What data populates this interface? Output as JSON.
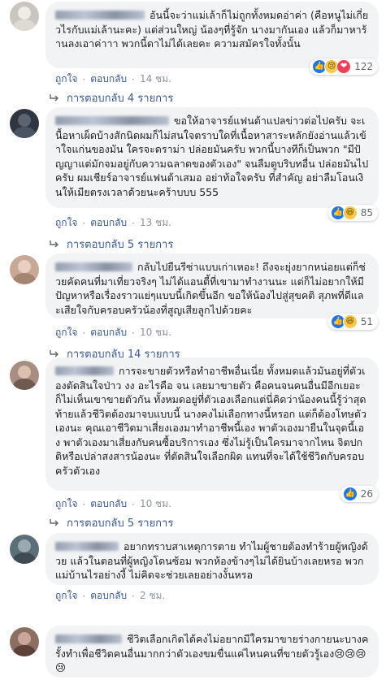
{
  "comments": [
    {
      "text": "อันนี้จะว่าแม่เล้าก็ไม่ถูกทั้งหมดอ่าค่า (คือหนูไม่เกี่ยวไรกับแม่เล้านะคะ) แต่ส่วนใหญ่ น้องๆที่รู้จัก นางมากันเอง แล้วก็มาหาร้านลงเอาค่าาา พวกนี้ดาไม่ได้เลยคะ ความสมัครใจทั้งนั้น",
      "like": "ถูกใจ",
      "reply": "ตอบกลับ",
      "time": "14 ชม.",
      "reactions": [
        "like",
        "sad",
        "love"
      ],
      "reaction_count": "122",
      "replies_label": "การตอบกลับ 4 รายการ",
      "avatar_color": "#b8b4ad"
    },
    {
      "text": "ขอให้อาจารย์แฟนต้าแปลข่าวต่อไปครับ จะเนื้อหาเผ็ดบ้างสักนิดผมก็ไม่สนใจตราบใดที่เนื้อหาสาระหลักยังอ่านแล้วเข้าใจแก่นของมัน ใครจะดราม่า ปล่อยมันครับ พวกนี้บางทีก็เป็นพวก \"มีปัญญาแต่มักจมอยู่กับความฉลาดของตัวเอง\" จนลืมดูบริบทอื่น ปล่อยมันไปครับ ผมเชียร์อาจารย์แฟนต้าเสมอ อย่าท้อใจครับ ที่สำคัญ อย่าลืมโอนเงินให้เมียตรงเวลาด้วยนะคร้าบบบ 555",
      "like": "ถูกใจ",
      "reply": "ตอบกลับ",
      "time": "13 ชม.",
      "reactions": [
        "like",
        "haha"
      ],
      "reaction_count": "85",
      "replies_label": "การตอบกลับ 5 รายการ",
      "avatar_color": "#3d4550"
    },
    {
      "text": "กลับไปยืนรีซ่าแบบเก่าเหอะ! ถึงจะยุ่งยากหน่อยแต่ก็ช่วยคัดคนที่มาเที่ยวจริงๆ ไม่ได้แอนตี้ที่เขามาทำงานนะ แต่ก็ไม่อยากให้มีปัญหาหรือเรื่องราวแย่ๆแบบนี้เกิดขึ้นอีก ขอให้น้องไปสู่สุขคติ สุภพที่ดีและเสียใจกับครอบครัวน้องที่สูญเสียลูกไปด้วยคะ",
      "like": "ถูกใจ",
      "reply": "ตอบกลับ",
      "time": "10 ชม.",
      "reactions": [
        "like",
        "haha"
      ],
      "reaction_count": "51",
      "replies_label": "การตอบกลับ 14 รายการ",
      "avatar_color": "#d6b7a8"
    },
    {
      "text": "การจะขายตัวหรือทำอาชีพอื่นเนี่ย ทั้งหมดแล้วมันอยู่ที่ตัวเองตัดสินใจป่าว งง อะไรคือ จน เลยมาขายตัว คือคนจนคนอื่นมีอีกเยอะ ก็ไม่เห็นเขาขายตัวกัน ทั้งหมดอยู่ที่ตัวเองเลือกแต่นี่คิดว่าน้องคนนี้รู้ว่าสุดท้ายแล้วชีวิตต้องมาจบแบบนี้ นางคงไม่เลือกทางนี้หรอก แต่ก็ต้องโทษตัวเองนะ คุณเอาชีวิตมาเสี่ยงเองมาทำอาชีพนี้เอง พาตัวเองมายืนในจุดนี้เอง พาตัวเองมาเสี่ยงกับคนซื้อบริการเอง ซึ่งไม่รู้เป็นใครมาจากไหน จิตปกติหรือเปล่าสงสารน้องนะ ที่ตัดสินใจเลือกผิด แทนที่จะได้ใช้ชีวิตกับครอบครัวตัวเอง",
      "like": "ถูกใจ",
      "reply": "ตอบกลับ",
      "time": "10 ชม.",
      "reactions": [
        "like"
      ],
      "reaction_count": "26",
      "replies_label": "การตอบกลับ 5 รายการ",
      "avatar_color": "#b39d92"
    },
    {
      "text": "อยากทราบสาเหตุการตาย ทำไมผู้ชายต้องทำร้ายผู้หญิงด้วย แล้วในตอนที่ผู้หญิงโดนซ้อม พวกห้องข้างๆไม่ได้ยินบ้างเลยหรอ พวกแม่บ้านไรอย่างงี้ ไม่คิดจะช่วยเลยอย่างงั้นหรอ",
      "like": "ถูกใจ",
      "reply": "ตอบกลับ",
      "time": "2 ชม.",
      "reactions": [],
      "reaction_count": "",
      "replies_label": "",
      "avatar_color": "#6b7f8a"
    },
    {
      "text": "ชีวิตเลือกเกิดได้คงไม่อยากมีใครมาขายร่างกายนะบางครั้งทำเพื่อชีวิตคนอื่นมากกว่าตัวเองขมขื่นแค่ไหนคนที่ขายตัวรู้เอง😢😢😢😢",
      "like": "",
      "reply": "",
      "time": "",
      "reactions": [],
      "reaction_count": "",
      "replies_label": "",
      "avatar_color": "#8d6e63"
    }
  ],
  "icons": {
    "like": "👍",
    "haha": "😆",
    "sad": "😢",
    "love": "❤"
  }
}
